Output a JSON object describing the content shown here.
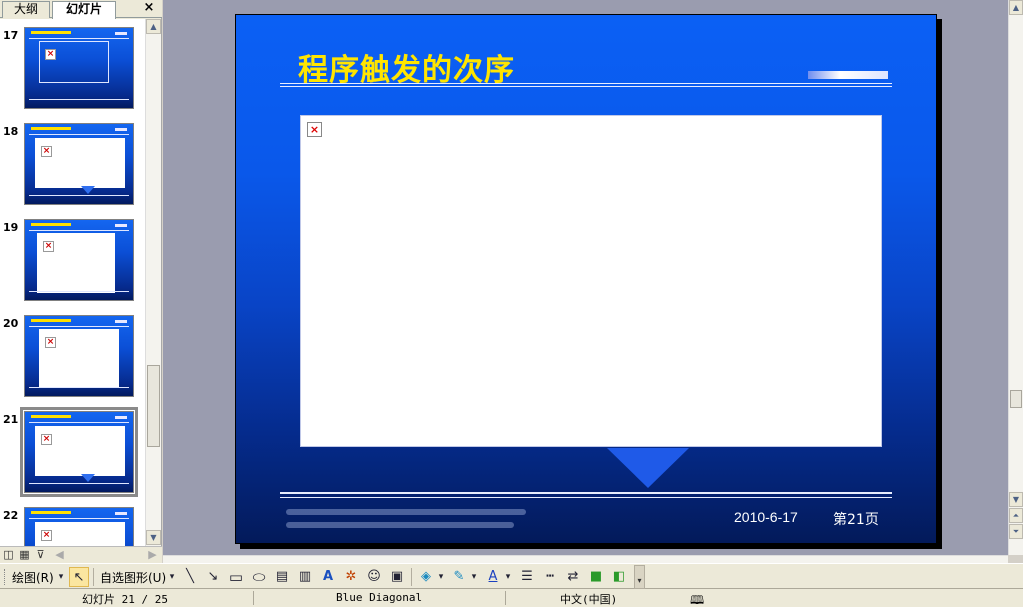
{
  "panel": {
    "tab_outline": "大纲",
    "tab_slides": "幻灯片",
    "close_symbol": "×"
  },
  "thumbnails": [
    {
      "number": "17"
    },
    {
      "number": "18"
    },
    {
      "number": "19"
    },
    {
      "number": "20"
    },
    {
      "number": "21",
      "selected": true
    },
    {
      "number": "22"
    }
  ],
  "slide": {
    "title": "程序触发的次序",
    "date": "2010-6-17",
    "page": "第21页",
    "broken_image_symbol": "×"
  },
  "toolbar": {
    "draw_label": "绘图(R)",
    "autoshape_label": "自选图形(U)"
  },
  "status": {
    "slide_info": "幻灯片 21 / 25",
    "design": "Blue Diagonal",
    "language": "中文(中国)"
  }
}
